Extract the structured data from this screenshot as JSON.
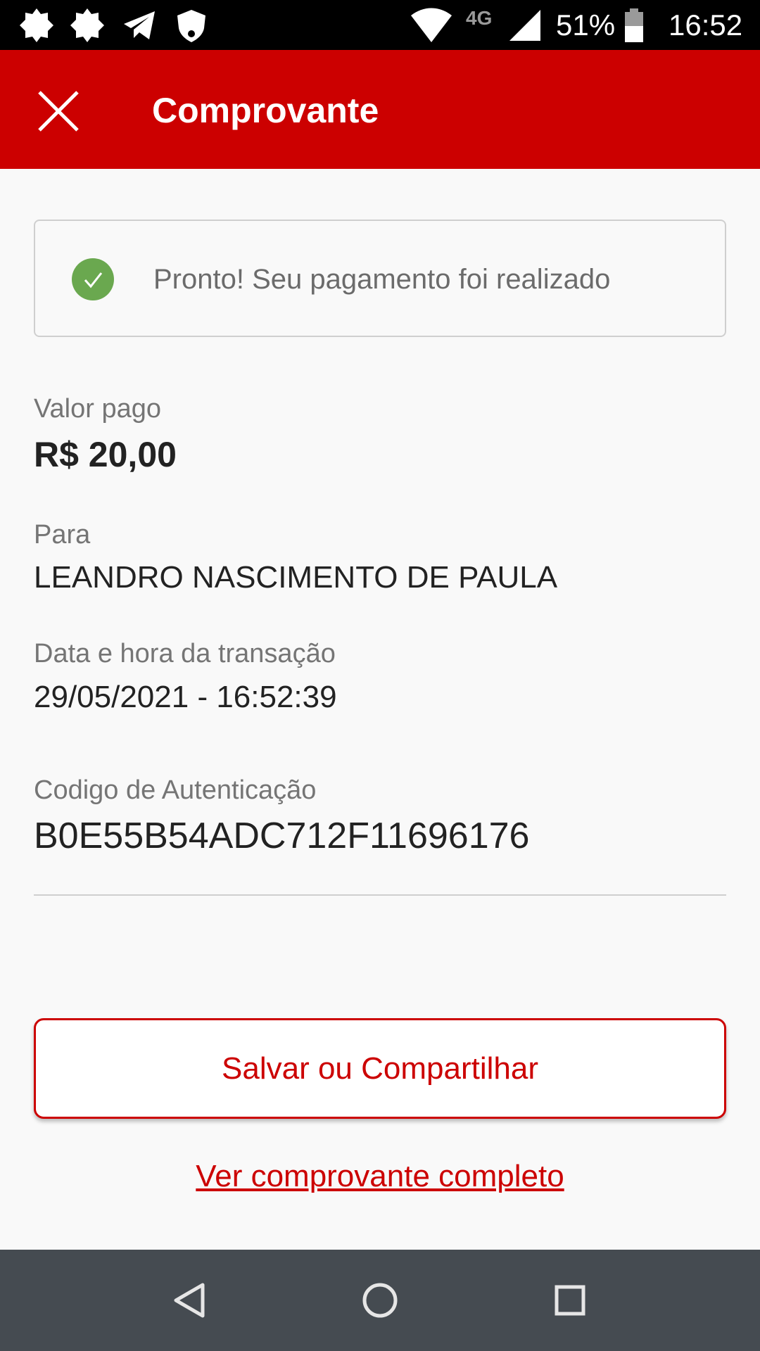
{
  "status_bar": {
    "network": "4G",
    "battery": "51%",
    "time": "16:52",
    "left_icons": [
      "settings-badge-icon",
      "settings-badge-icon",
      "telegram-icon",
      "shield-icon"
    ],
    "right_icons": [
      "wifi-icon",
      "signal-icon",
      "battery-icon"
    ]
  },
  "header": {
    "title": "Comprovante",
    "close_icon": "close-icon"
  },
  "success": {
    "message": "Pronto! Seu pagamento foi realizado",
    "icon": "check-circle-icon",
    "color": "#6aa84f"
  },
  "details": {
    "amount_label": "Valor pago",
    "amount_value": "R$ 20,00",
    "recipient_label": "Para",
    "recipient_value": "LEANDRO NASCIMENTO DE PAULA",
    "datetime_label": "Data e hora da transação",
    "datetime_value": "29/05/2021 - 16:52:39",
    "auth_label": "Codigo de Autenticação",
    "auth_value": "B0E55B54ADC712F11696176"
  },
  "actions": {
    "save_share_label": "Salvar ou Compartilhar",
    "full_receipt_label": "Ver comprovante completo"
  },
  "nav": {
    "back_icon": "back-triangle-icon",
    "home_icon": "home-circle-icon",
    "recents_icon": "recents-square-icon"
  },
  "colors": {
    "brand": "#cc0000",
    "success": "#6aa84f",
    "nav_bar": "#454b51"
  }
}
